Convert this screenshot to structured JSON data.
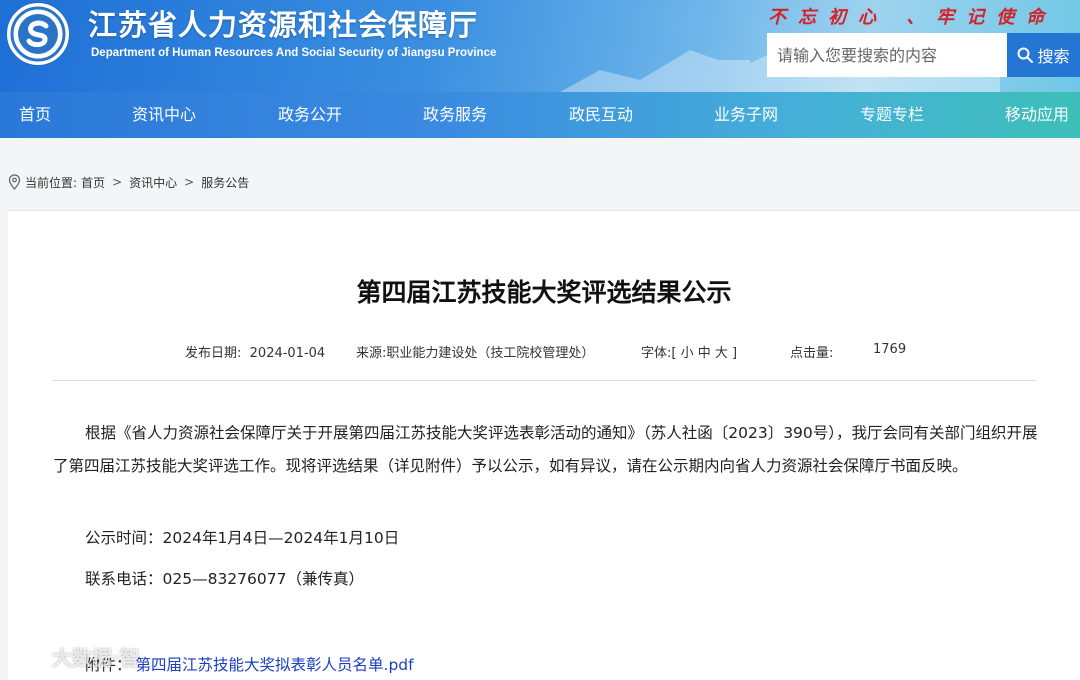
{
  "site": {
    "title": "江苏省人力资源和社会保障厅",
    "subtitle": "Department of Human Resources And Social Security of Jiangsu Province",
    "slogan": "不忘初心 、牢记使命"
  },
  "search": {
    "placeholder": "请输入您要搜索的内容",
    "button_label": "搜索"
  },
  "nav": {
    "items": [
      {
        "label": "首页"
      },
      {
        "label": "资讯中心"
      },
      {
        "label": "政务公开"
      },
      {
        "label": "政务服务"
      },
      {
        "label": "政民互动"
      },
      {
        "label": "业务子网"
      },
      {
        "label": "专题专栏"
      },
      {
        "label": "移动应用"
      }
    ]
  },
  "breadcrumb": {
    "prefix": "当前位置:",
    "items": [
      "首页",
      "资讯中心",
      "服务公告"
    ],
    "separator": ">"
  },
  "article": {
    "title": "第四届江苏技能大奖评选结果公示",
    "meta": {
      "date_label": "发布日期:",
      "date": "2024-01-04",
      "source_label": "来源:",
      "source": "职业能力建设处（技工院校管理处）",
      "font_label": "字体:",
      "font_options": "[ 小 中 大 ]",
      "views_label": "点击量:",
      "views": "1769"
    },
    "paragraphs": [
      "根据《省人力资源社会保障厅关于开展第四届江苏技能大奖评选表彰活动的通知》（苏人社函〔2023〕390号），我厅会同有关部门组织开展了第四届江苏技能大奖评选工作。现将评选结果（详见附件）予以公示，如有异议，请在公示期内向省人力资源社会保障厅书面反映。",
      "公示时间：2024年1月4日—2024年1月10日",
      "联系电话：025—83276077（兼传真）"
    ],
    "attachment_label": "附件：",
    "attachment_name": "第四届江苏技能大奖拟表彰人员名单.pdf"
  },
  "watermark": {
    "text": "大数据·智"
  },
  "colors": {
    "header_blue": "#1e6fd6",
    "slogan_red": "#d3232a",
    "link_blue": "#1a3fbf"
  }
}
